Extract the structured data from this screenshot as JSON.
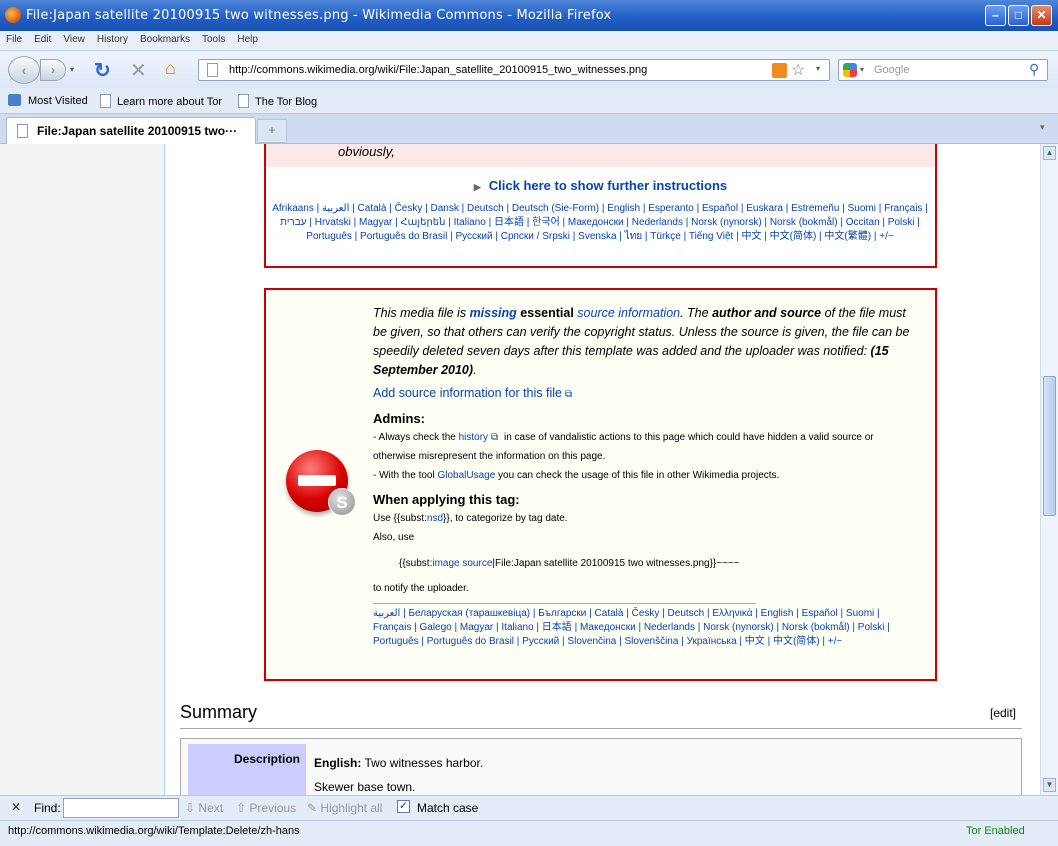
{
  "window": {
    "title": "File:Japan satellite 20100915 two witnesses.png - Wikimedia Commons - Mozilla Firefox"
  },
  "menu": [
    "File",
    "Edit",
    "View",
    "History",
    "Bookmarks",
    "Tools",
    "Help"
  ],
  "nav": {
    "url": "http://commons.wikimedia.org/wiki/File:Japan_satellite_20100915_two_witnesses.png",
    "search_placeholder": "Google"
  },
  "bookmarks": [
    "Most Visited",
    "Learn more about Tor",
    "The Tor Blog"
  ],
  "tabs": [
    {
      "label": "File:Japan satellite 20100915 two···"
    }
  ],
  "box1": {
    "obviously": "obviously,",
    "click_here": "Click here to show further instructions",
    "langs": "Afrikaans | العربية | Català | Česky | Dansk | Deutsch | Deutsch (Sie-Form) | English | Esperanto | Español | Euskara | Estremeñu | Suomi | Français | עברית | Hrvatski | Magyar | Հայերեն | Italiano | 日本語 | 한국어 | Македонски | Nederlands | Norsk (nynorsk) | Norsk (bokmål) | Occitan | Polski | Português | Português do Brasil | Русский | Српски / Srpski | Svenska | ไทย | Türkçe | Tiếng Việt | 中文 | 中文(简体) | 中文(繁體) | +/−"
  },
  "box2": {
    "p1_a": "This media file is ",
    "p1_missing": "missing",
    "p1_b": " essential ",
    "p1_source": "source information",
    "p1_c": ". The ",
    "p1_author": "author and source",
    "p1_d": " of the file must be given, so that others can verify the copyright status. Unless the source is given, the file can be speedily deleted seven days after this template was added and the uploader was notified: ",
    "p1_date": "(15 September 2010)",
    "p1_end": ".",
    "add_source": "Add source information for this file",
    "admins_heading": "Admins:",
    "admin1_a": "- Always check the ",
    "admin1_history": "history",
    "admin1_b": " in case of vandalistic actions to this page which could have hidden a valid source or otherwise misrepresent the information on this page.",
    "admin2_a": "- With the tool ",
    "admin2_tool": "GlobalUsage",
    "admin2_b": " you can check the usage of this file in other Wikimedia projects.",
    "apply_heading": "When applying this tag:",
    "apply1_a": "Use {{subst:",
    "apply1_nsd": "nsd",
    "apply1_b": "}}, to categorize by tag date.",
    "apply2": "Also, use",
    "apply3_a": "{{subst:",
    "apply3_link": "image source",
    "apply3_b": "|File:Japan satellite 20100915 two witnesses.png}}~~~~",
    "apply4": "to notify the uploader.",
    "langs": "العربية | Беларуская (тарашкевіца) | Български | Català | Česky | Deutsch | Ελληνικά | English | Español | Suomi | Français | Galego | Magyar | Italiano | 日本語 | Македонски | Nederlands | Norsk (nynorsk) | Norsk (bokmål) | Polski | Português | Português do Brasil | Русский | Slovenčina | Slovenščina | Українська | 中文 | 中文(简体) | +/−"
  },
  "summary": {
    "heading": "Summary",
    "edit": "[edit]",
    "desc_label": "Description",
    "desc_lang": "English:",
    "desc_line1": " Two witnesses harbor.",
    "desc_line2": "Skewer base town."
  },
  "findbar": {
    "find_label": "Find:",
    "next": "Next",
    "previous": "Previous",
    "highlight": "Highlight all",
    "match_case": "Match case"
  },
  "status": {
    "url": "http://commons.wikimedia.org/wiki/Template:Delete/zh-hans",
    "tor": "Tor Enabled"
  }
}
